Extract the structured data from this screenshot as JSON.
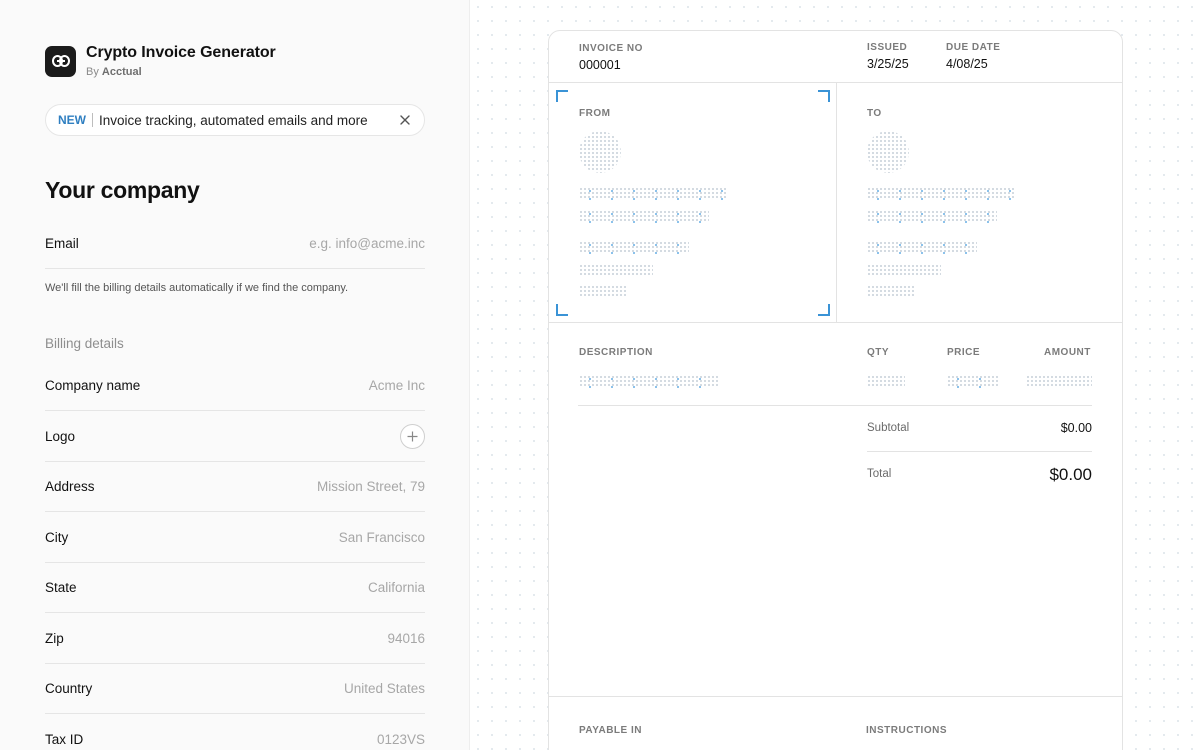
{
  "brand": {
    "title": "Crypto Invoice Generator",
    "by_prefix": "By",
    "by_name": "Acctual",
    "logo_icon": "link-icon"
  },
  "banner": {
    "tag": "NEW",
    "text": "Invoice tracking, automated emails and more",
    "close_icon": "close-icon"
  },
  "form": {
    "section_title": "Your company",
    "email": {
      "label": "Email",
      "placeholder": "e.g. info@acme.inc",
      "value": ""
    },
    "helper": "We'll fill the billing details automatically if we find the company.",
    "billing_heading": "Billing details",
    "fields": [
      {
        "key": "company",
        "label": "Company name",
        "placeholder": "Acme Inc"
      },
      {
        "key": "logo",
        "label": "Logo",
        "icon": "plus-icon"
      },
      {
        "key": "address",
        "label": "Address",
        "placeholder": "Mission Street, 79"
      },
      {
        "key": "city",
        "label": "City",
        "placeholder": "San Francisco"
      },
      {
        "key": "state",
        "label": "State",
        "placeholder": "California"
      },
      {
        "key": "zip",
        "label": "Zip",
        "placeholder": "94016"
      },
      {
        "key": "country",
        "label": "Country",
        "placeholder": "United States"
      },
      {
        "key": "tax",
        "label": "Tax ID",
        "placeholder": "0123VS"
      }
    ]
  },
  "invoice": {
    "number_label": "INVOICE NO",
    "number": "000001",
    "issued_label": "ISSUED",
    "issued": "3/25/25",
    "due_label": "DUE DATE",
    "due": "4/08/25",
    "from_label": "FROM",
    "to_label": "TO",
    "columns": {
      "description": "DESCRIPTION",
      "qty": "QTY",
      "price": "PRICE",
      "amount": "AMOUNT"
    },
    "subtotal_label": "Subtotal",
    "subtotal": "$0.00",
    "total_label": "Total",
    "total": "$0.00",
    "payable_label": "PAYABLE IN",
    "instructions_label": "INSTRUCTIONS",
    "accent_color": "#3a93d6"
  }
}
